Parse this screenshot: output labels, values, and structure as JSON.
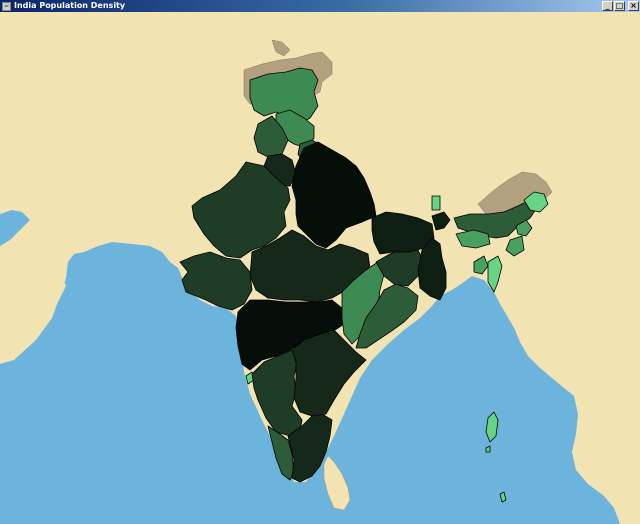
{
  "window": {
    "title": "India Population Density",
    "minimize_glyph": "_",
    "maximize_glyph": "□",
    "close_glyph": "×",
    "app_icon": "java-cup-icon"
  },
  "colors": {
    "land_background": "#f1e3b2",
    "sea": "#6cb4dc",
    "neighbour_region": "#b3a07e",
    "density_darkest": "#050e08",
    "density_very_high": "#0d1f13",
    "density_high": "#15281a",
    "density_medium_high": "#1f3d26",
    "density_medium": "#2d5c38",
    "density_low": "#3d8a52",
    "density_very_low": "#4aa05f",
    "density_lowest": "#66d484"
  }
}
